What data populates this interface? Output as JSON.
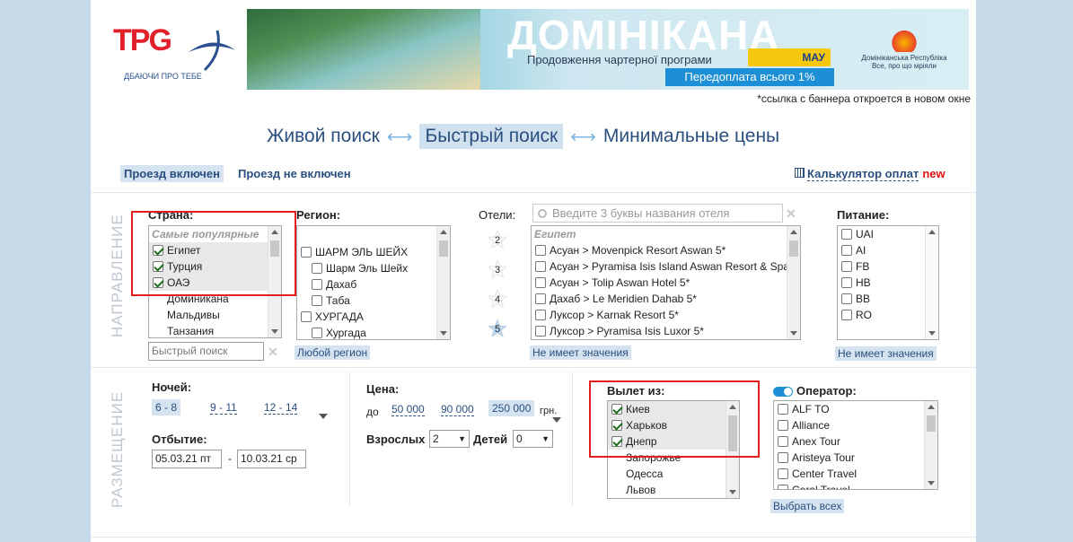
{
  "logo": {
    "text": "TPG",
    "tagline": "ДБАЮЧИ ПРО ТЕБЕ"
  },
  "banner": {
    "title": "ДОМІНІКАНА",
    "subtitle": "Продовження чартерної програми",
    "airline": "МАУ",
    "prepay": "Передоплата всього 1%",
    "country": "Домініканська Республіка",
    "country_slogan": "Все, про що мріяли"
  },
  "banner_note": "*ссылка с баннера откроется в новом окне",
  "modes": {
    "live": "Живой поиск",
    "quick": "Быстрый поиск",
    "min": "Минимальные цены"
  },
  "tabs": {
    "incl": "Проезд включен",
    "not_incl": "Проезд не включен"
  },
  "calc": {
    "label": "Калькулятор оплат",
    "badge": "new"
  },
  "section1": "НАПРАВЛЕНИЕ",
  "section2": "РАЗМЕЩЕНИЕ",
  "country": {
    "label": "Страна:",
    "group": "Самые популярные",
    "items": [
      {
        "name": "Египет",
        "checked": true,
        "hl": true
      },
      {
        "name": "Турция",
        "checked": true,
        "hl": true
      },
      {
        "name": "ОАЭ",
        "checked": true,
        "hl": true
      },
      {
        "name": "Доминикана",
        "checked": false,
        "hl": false
      },
      {
        "name": "Мальдивы",
        "checked": false,
        "hl": false
      },
      {
        "name": "Танзания",
        "checked": false,
        "hl": false
      }
    ],
    "quick_placeholder": "Быстрый поиск"
  },
  "region": {
    "label": "Регион:",
    "items": [
      {
        "name": "ШАРМ ЭЛЬ ШЕЙХ",
        "indent": false
      },
      {
        "name": "Шарм Эль Шейх",
        "indent": true
      },
      {
        "name": "Дахаб",
        "indent": true
      },
      {
        "name": "Таба",
        "indent": true
      },
      {
        "name": "ХУРГАДА",
        "indent": false
      },
      {
        "name": "Хургада",
        "indent": true
      }
    ],
    "any": "Любой регион"
  },
  "hotels": {
    "label": "Отели:",
    "placeholder": "Введите 3 буквы названия отеля",
    "group": "Египет",
    "stars": [
      "2",
      "3",
      "4",
      "5"
    ],
    "items": [
      "Асуан > Movenpick Resort Aswan 5*",
      "Асуан > Pyramisa Isis Island Aswan Resort & Spa",
      "Асуан > Tolip Aswan Hotel 5*",
      "Дахаб > Le Meridien Dahab 5*",
      "Луксор > Karnak Resort 5*",
      "Луксор > Pyramisa Isis Luxor 5*"
    ],
    "none": "Не имеет значения"
  },
  "food": {
    "label": "Питание:",
    "items": [
      "UAI",
      "AI",
      "FB",
      "HB",
      "BB",
      "RO"
    ],
    "none": "Не имеет значения"
  },
  "nights": {
    "label": "Ночей:",
    "opts": [
      "6 - 8",
      "9 - 11",
      "12 - 14"
    ]
  },
  "departure": {
    "label": "Отбытие:",
    "from": "05.03.21 пт",
    "dash": "-",
    "to": "10.03.21 ср"
  },
  "price": {
    "label": "Цена:",
    "prefix": "до",
    "opts": [
      "50 000",
      "90 000",
      "250 000"
    ],
    "unit": "грн."
  },
  "adults": {
    "label": "Взрослых",
    "value": "2"
  },
  "kids": {
    "label": "Детей",
    "value": "0"
  },
  "from_city": {
    "label": "Вылет из:",
    "items": [
      {
        "name": "Киев",
        "checked": true,
        "hl": true
      },
      {
        "name": "Харьков",
        "checked": true,
        "hl": true
      },
      {
        "name": "Днепр",
        "checked": true,
        "hl": true
      },
      {
        "name": "Запорожье",
        "checked": false,
        "hl": false
      },
      {
        "name": "Одесса",
        "checked": false,
        "hl": false
      },
      {
        "name": "Львов",
        "checked": false,
        "hl": false
      }
    ]
  },
  "operator": {
    "label": "Оператор:",
    "items": [
      "ALF TO",
      "Alliance",
      "Anex Tour",
      "Aristeya Tour",
      "Center Travel",
      "Coral Travel"
    ],
    "select_all": "Выбрать всех"
  }
}
